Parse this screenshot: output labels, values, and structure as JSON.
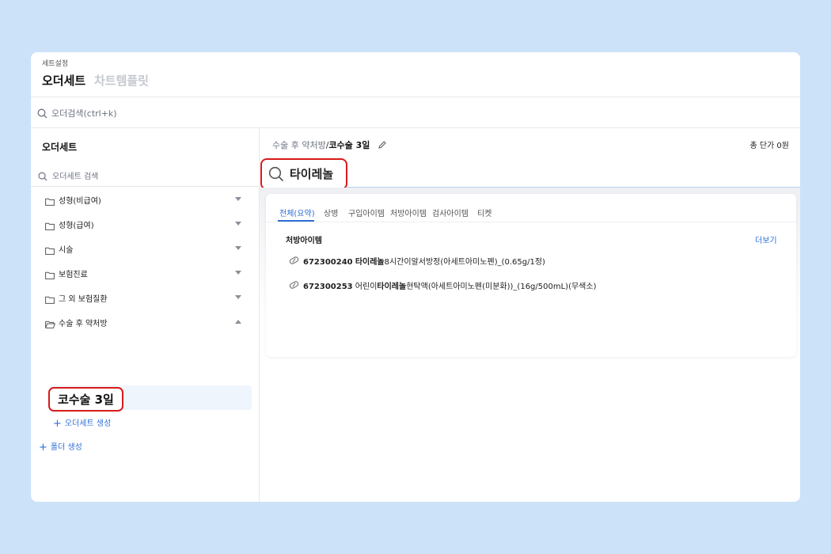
{
  "header": {
    "section": "세트설정",
    "tab_active": "오더세트",
    "tab_inactive": "차트템플릿"
  },
  "global_search": {
    "placeholder": "오더검색(ctrl+k)"
  },
  "sidebar": {
    "title": "오더세트",
    "search_placeholder": "오더세트 검색",
    "folders": [
      {
        "label": "성형(비급여)",
        "expanded": false
      },
      {
        "label": "성형(급여)",
        "expanded": false
      },
      {
        "label": "시술",
        "expanded": false
      },
      {
        "label": "보험진료",
        "expanded": false
      },
      {
        "label": "그 외 보험질환",
        "expanded": false
      },
      {
        "label": "수술 후 약처방",
        "expanded": true
      }
    ],
    "selected_item": "코수술 3일",
    "add_set": "오더세트 생성",
    "add_folder": "폴더 생성"
  },
  "main": {
    "breadcrumb_parent": "수술 후 약처방",
    "breadcrumb_sep": "/",
    "breadcrumb_current": "코수술 3일",
    "total_price": "총 단가 0원",
    "search_value": "타이레놀",
    "tabs": [
      "전체(요약)",
      "상병",
      "구입아이템",
      "처방아이템",
      "검사아이템",
      "티켓"
    ],
    "active_tab": "전체(요약)",
    "section_title": "처방아이템",
    "more_label": "더보기",
    "results": [
      {
        "code": "672300240",
        "prefix": " ",
        "match": "타이레놀",
        "suffix": "8시간이알서방정(아세트아미노펜)_(0.65g/1정)"
      },
      {
        "code": "672300253",
        "prefix": " 어린이",
        "match": "타이레놀",
        "suffix": "현탁액(아세트아미노펜(미분화))_(16g/500mL)(무색소)"
      }
    ]
  },
  "colors": {
    "background": "#cce2f8",
    "accent": "#2f6fd6",
    "highlight": "#d81b1b"
  }
}
